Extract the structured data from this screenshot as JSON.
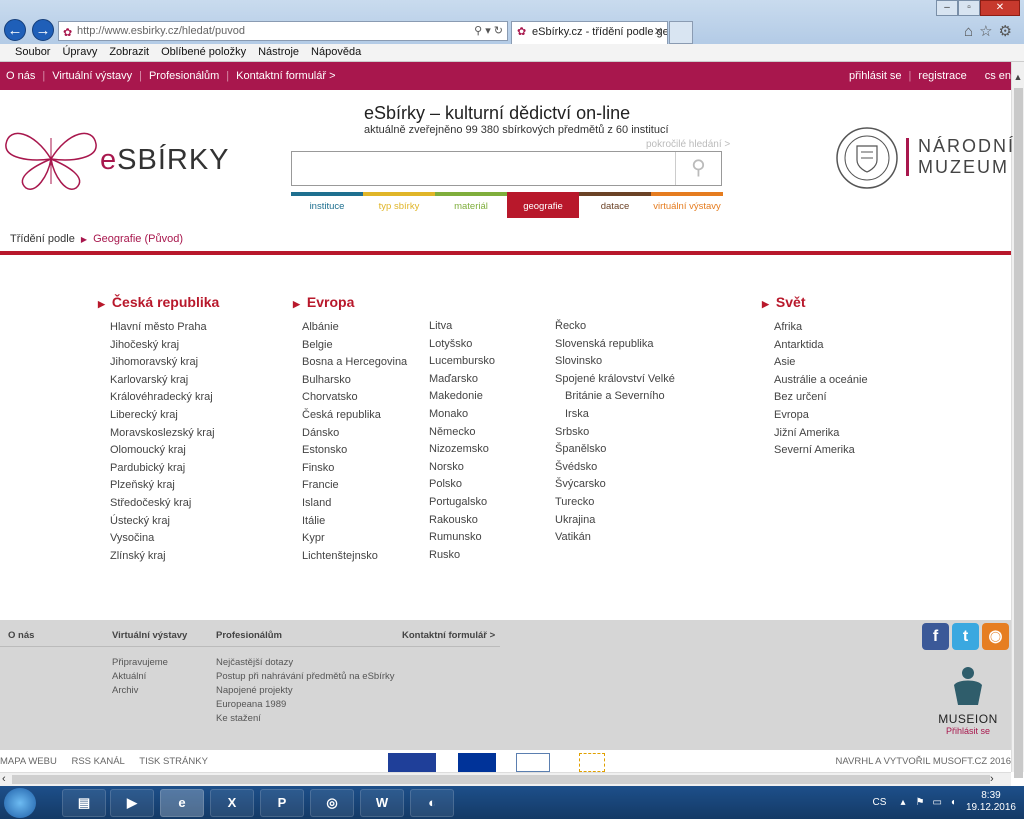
{
  "browser": {
    "url": "http://www.esbirky.cz/hledat/puvod",
    "tab_title": "eSbírky.cz - třídění podle ge...",
    "menu": [
      "Soubor",
      "Úpravy",
      "Zobrazit",
      "Oblíbené položky",
      "Nástroje",
      "Nápověda"
    ]
  },
  "topnav": {
    "left": [
      "O nás",
      "Virtuální výstavy",
      "Profesionálům",
      "Kontaktní formulář >"
    ],
    "login": "přihlásit se",
    "register": "registrace",
    "lang": "cs  en"
  },
  "header": {
    "logo_e": "e",
    "logo_rest": "SBÍRKY",
    "title": "eSbírky – kulturní dědictví on-line",
    "subtitle": "aktuálně zveřejněno 99 380 sbírkových předmětů z 60 institucí",
    "advanced_search": "pokročilé hledání >",
    "search_placeholder": "",
    "museum_line1": "NÁRODNÍ",
    "museum_line2": "MUZEUM"
  },
  "filter_tabs": [
    {
      "label": "instituce",
      "color": "#1e6f8f",
      "active": false
    },
    {
      "label": "typ sbírky",
      "color": "#e0b528",
      "active": false
    },
    {
      "label": "materiál",
      "color": "#7fae3c",
      "active": false
    },
    {
      "label": "geografie (původ)",
      "color": "#b8182b",
      "active": true
    },
    {
      "label": "datace",
      "color": "#6b4226",
      "active": false
    },
    {
      "label": "virtuální výstavy",
      "color": "#e57c1f",
      "active": false
    }
  ],
  "breadcrumb": {
    "root": "Třídění podle",
    "current": "Geografie (Původ)"
  },
  "regions": {
    "cr_title": "Česká republika",
    "cr": [
      "Hlavní město Praha",
      "Jihočeský kraj",
      "Jihomoravský kraj",
      "Karlovarský kraj",
      "Královéhradecký kraj",
      "Liberecký kraj",
      "Moravskoslezský kraj",
      "Olomoucký kraj",
      "Pardubický kraj",
      "Plzeňský kraj",
      "Středočeský kraj",
      "Ústecký kraj",
      "Vysočina",
      "Zlínský kraj"
    ],
    "eu_title": "Evropa",
    "eu1": [
      "Albánie",
      "Belgie",
      "Bosna a Hercegovina",
      "Bulharsko",
      "Chorvatsko",
      "Česká republika",
      "Dánsko",
      "Estonsko",
      "Finsko",
      "Francie",
      "Island",
      "Itálie",
      "Kypr",
      "Lichtenštejnsko"
    ],
    "eu2": [
      "Litva",
      "Lotyšsko",
      "Lucembursko",
      "Maďarsko",
      "Makedonie",
      "Monako",
      "Německo",
      "Nizozemsko",
      "Norsko",
      "Polsko",
      "Portugalsko",
      "Rakousko",
      "Rumunsko",
      "Rusko"
    ],
    "eu3": [
      "Řecko",
      "Slovenská republika",
      "Slovinsko",
      "Spojené království Velké",
      "Británie a Severního",
      "Irska",
      "Srbsko",
      "Španělsko",
      "Švédsko",
      "Švýcarsko",
      "Turecko",
      "Ukrajina",
      "Vatikán"
    ],
    "world_title": "Svět",
    "world": [
      "Afrika",
      "Antarktida",
      "Asie",
      "Austrálie a oceánie",
      "Bez určení",
      "Evropa",
      "Jižní Amerika",
      "Severní Amerika"
    ]
  },
  "footer": {
    "col1_h": "O nás",
    "col2_h": "Virtuální výstavy",
    "col2": [
      "Připravujeme",
      "Aktuální",
      "Archiv"
    ],
    "col3_h": "Profesionálům",
    "col3": [
      "Nejčastější dotazy",
      "Postup při nahrávání předmětů na eSbírky",
      "Napojené projekty",
      "Europeana 1989",
      "Ke stažení"
    ],
    "col4_h": "Kontaktní formulář >",
    "museion": "MUSEION",
    "museion_login": "Přihlásit se"
  },
  "bottombar": {
    "links": [
      "MAPA WEBU",
      "RSS KANÁL",
      "TISK STRÁNKY"
    ],
    "credit": "NAVRHL A VYTVOŘIL MUSOFT.CZ 2016"
  },
  "taskbar": {
    "lang": "CS",
    "time": "8:39",
    "date": "19.12.2016"
  }
}
